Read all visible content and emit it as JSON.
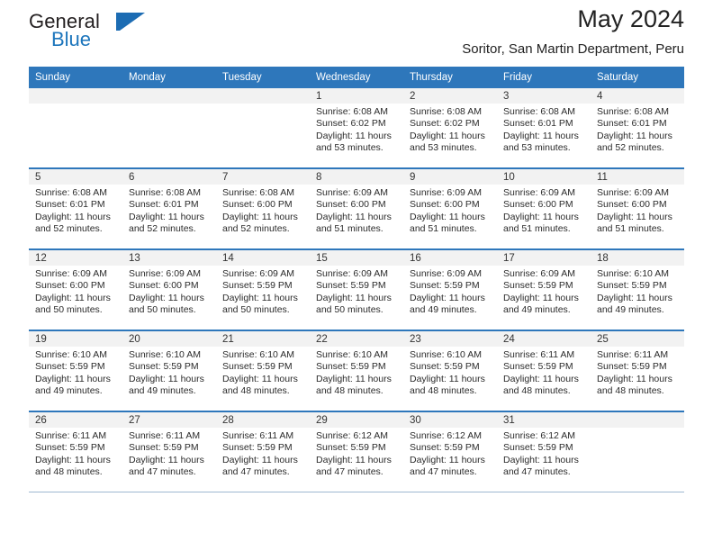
{
  "brand": {
    "name_part1": "General",
    "name_part2": "Blue",
    "triangle_color": "#1c6cb3",
    "blue_text_color": "#1c75bc"
  },
  "header": {
    "title": "May 2024",
    "subtitle": "Soritor, San Martin Department, Peru"
  },
  "theme": {
    "header_blue": "#2e77bb",
    "daynum_band": "#f2f2f2",
    "row_divider": "#2e77bb"
  },
  "weekdays": [
    "Sunday",
    "Monday",
    "Tuesday",
    "Wednesday",
    "Thursday",
    "Friday",
    "Saturday"
  ],
  "labels": {
    "sunrise_prefix": "Sunrise:",
    "sunset_prefix": "Sunset:",
    "daylight_prefix": "Daylight:"
  },
  "weeks": [
    [
      {
        "day": "",
        "sunrise": "",
        "sunset": "",
        "daylight_line1": "",
        "daylight_line2": ""
      },
      {
        "day": "",
        "sunrise": "",
        "sunset": "",
        "daylight_line1": "",
        "daylight_line2": ""
      },
      {
        "day": "",
        "sunrise": "",
        "sunset": "",
        "daylight_line1": "",
        "daylight_line2": ""
      },
      {
        "day": "1",
        "sunrise": "Sunrise: 6:08 AM",
        "sunset": "Sunset: 6:02 PM",
        "daylight_line1": "Daylight: 11 hours",
        "daylight_line2": "and 53 minutes."
      },
      {
        "day": "2",
        "sunrise": "Sunrise: 6:08 AM",
        "sunset": "Sunset: 6:02 PM",
        "daylight_line1": "Daylight: 11 hours",
        "daylight_line2": "and 53 minutes."
      },
      {
        "day": "3",
        "sunrise": "Sunrise: 6:08 AM",
        "sunset": "Sunset: 6:01 PM",
        "daylight_line1": "Daylight: 11 hours",
        "daylight_line2": "and 53 minutes."
      },
      {
        "day": "4",
        "sunrise": "Sunrise: 6:08 AM",
        "sunset": "Sunset: 6:01 PM",
        "daylight_line1": "Daylight: 11 hours",
        "daylight_line2": "and 52 minutes."
      }
    ],
    [
      {
        "day": "5",
        "sunrise": "Sunrise: 6:08 AM",
        "sunset": "Sunset: 6:01 PM",
        "daylight_line1": "Daylight: 11 hours",
        "daylight_line2": "and 52 minutes."
      },
      {
        "day": "6",
        "sunrise": "Sunrise: 6:08 AM",
        "sunset": "Sunset: 6:01 PM",
        "daylight_line1": "Daylight: 11 hours",
        "daylight_line2": "and 52 minutes."
      },
      {
        "day": "7",
        "sunrise": "Sunrise: 6:08 AM",
        "sunset": "Sunset: 6:00 PM",
        "daylight_line1": "Daylight: 11 hours",
        "daylight_line2": "and 52 minutes."
      },
      {
        "day": "8",
        "sunrise": "Sunrise: 6:09 AM",
        "sunset": "Sunset: 6:00 PM",
        "daylight_line1": "Daylight: 11 hours",
        "daylight_line2": "and 51 minutes."
      },
      {
        "day": "9",
        "sunrise": "Sunrise: 6:09 AM",
        "sunset": "Sunset: 6:00 PM",
        "daylight_line1": "Daylight: 11 hours",
        "daylight_line2": "and 51 minutes."
      },
      {
        "day": "10",
        "sunrise": "Sunrise: 6:09 AM",
        "sunset": "Sunset: 6:00 PM",
        "daylight_line1": "Daylight: 11 hours",
        "daylight_line2": "and 51 minutes."
      },
      {
        "day": "11",
        "sunrise": "Sunrise: 6:09 AM",
        "sunset": "Sunset: 6:00 PM",
        "daylight_line1": "Daylight: 11 hours",
        "daylight_line2": "and 51 minutes."
      }
    ],
    [
      {
        "day": "12",
        "sunrise": "Sunrise: 6:09 AM",
        "sunset": "Sunset: 6:00 PM",
        "daylight_line1": "Daylight: 11 hours",
        "daylight_line2": "and 50 minutes."
      },
      {
        "day": "13",
        "sunrise": "Sunrise: 6:09 AM",
        "sunset": "Sunset: 6:00 PM",
        "daylight_line1": "Daylight: 11 hours",
        "daylight_line2": "and 50 minutes."
      },
      {
        "day": "14",
        "sunrise": "Sunrise: 6:09 AM",
        "sunset": "Sunset: 5:59 PM",
        "daylight_line1": "Daylight: 11 hours",
        "daylight_line2": "and 50 minutes."
      },
      {
        "day": "15",
        "sunrise": "Sunrise: 6:09 AM",
        "sunset": "Sunset: 5:59 PM",
        "daylight_line1": "Daylight: 11 hours",
        "daylight_line2": "and 50 minutes."
      },
      {
        "day": "16",
        "sunrise": "Sunrise: 6:09 AM",
        "sunset": "Sunset: 5:59 PM",
        "daylight_line1": "Daylight: 11 hours",
        "daylight_line2": "and 49 minutes."
      },
      {
        "day": "17",
        "sunrise": "Sunrise: 6:09 AM",
        "sunset": "Sunset: 5:59 PM",
        "daylight_line1": "Daylight: 11 hours",
        "daylight_line2": "and 49 minutes."
      },
      {
        "day": "18",
        "sunrise": "Sunrise: 6:10 AM",
        "sunset": "Sunset: 5:59 PM",
        "daylight_line1": "Daylight: 11 hours",
        "daylight_line2": "and 49 minutes."
      }
    ],
    [
      {
        "day": "19",
        "sunrise": "Sunrise: 6:10 AM",
        "sunset": "Sunset: 5:59 PM",
        "daylight_line1": "Daylight: 11 hours",
        "daylight_line2": "and 49 minutes."
      },
      {
        "day": "20",
        "sunrise": "Sunrise: 6:10 AM",
        "sunset": "Sunset: 5:59 PM",
        "daylight_line1": "Daylight: 11 hours",
        "daylight_line2": "and 49 minutes."
      },
      {
        "day": "21",
        "sunrise": "Sunrise: 6:10 AM",
        "sunset": "Sunset: 5:59 PM",
        "daylight_line1": "Daylight: 11 hours",
        "daylight_line2": "and 48 minutes."
      },
      {
        "day": "22",
        "sunrise": "Sunrise: 6:10 AM",
        "sunset": "Sunset: 5:59 PM",
        "daylight_line1": "Daylight: 11 hours",
        "daylight_line2": "and 48 minutes."
      },
      {
        "day": "23",
        "sunrise": "Sunrise: 6:10 AM",
        "sunset": "Sunset: 5:59 PM",
        "daylight_line1": "Daylight: 11 hours",
        "daylight_line2": "and 48 minutes."
      },
      {
        "day": "24",
        "sunrise": "Sunrise: 6:11 AM",
        "sunset": "Sunset: 5:59 PM",
        "daylight_line1": "Daylight: 11 hours",
        "daylight_line2": "and 48 minutes."
      },
      {
        "day": "25",
        "sunrise": "Sunrise: 6:11 AM",
        "sunset": "Sunset: 5:59 PM",
        "daylight_line1": "Daylight: 11 hours",
        "daylight_line2": "and 48 minutes."
      }
    ],
    [
      {
        "day": "26",
        "sunrise": "Sunrise: 6:11 AM",
        "sunset": "Sunset: 5:59 PM",
        "daylight_line1": "Daylight: 11 hours",
        "daylight_line2": "and 48 minutes."
      },
      {
        "day": "27",
        "sunrise": "Sunrise: 6:11 AM",
        "sunset": "Sunset: 5:59 PM",
        "daylight_line1": "Daylight: 11 hours",
        "daylight_line2": "and 47 minutes."
      },
      {
        "day": "28",
        "sunrise": "Sunrise: 6:11 AM",
        "sunset": "Sunset: 5:59 PM",
        "daylight_line1": "Daylight: 11 hours",
        "daylight_line2": "and 47 minutes."
      },
      {
        "day": "29",
        "sunrise": "Sunrise: 6:12 AM",
        "sunset": "Sunset: 5:59 PM",
        "daylight_line1": "Daylight: 11 hours",
        "daylight_line2": "and 47 minutes."
      },
      {
        "day": "30",
        "sunrise": "Sunrise: 6:12 AM",
        "sunset": "Sunset: 5:59 PM",
        "daylight_line1": "Daylight: 11 hours",
        "daylight_line2": "and 47 minutes."
      },
      {
        "day": "31",
        "sunrise": "Sunrise: 6:12 AM",
        "sunset": "Sunset: 5:59 PM",
        "daylight_line1": "Daylight: 11 hours",
        "daylight_line2": "and 47 minutes."
      },
      {
        "day": "",
        "sunrise": "",
        "sunset": "",
        "daylight_line1": "",
        "daylight_line2": ""
      }
    ]
  ]
}
